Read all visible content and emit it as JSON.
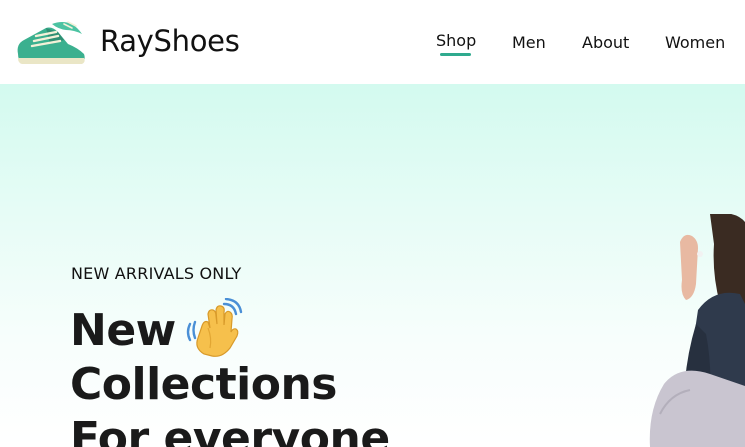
{
  "brand": {
    "name": "RayShoes",
    "logo_icon": "sneaker-icon"
  },
  "nav": {
    "items": [
      {
        "label": "Shop",
        "active": true
      },
      {
        "label": "Men"
      },
      {
        "label": "About"
      },
      {
        "label": "Women"
      }
    ]
  },
  "hero": {
    "eyebrow": "NEW ARRIVALS ONLY",
    "headline": [
      "New",
      "Collections",
      "For everyone"
    ],
    "wave_icon": "waving-hand-icon"
  },
  "colors": {
    "accent": "#2faa8e",
    "hero_top": "#d3faef",
    "text": "#111111"
  }
}
